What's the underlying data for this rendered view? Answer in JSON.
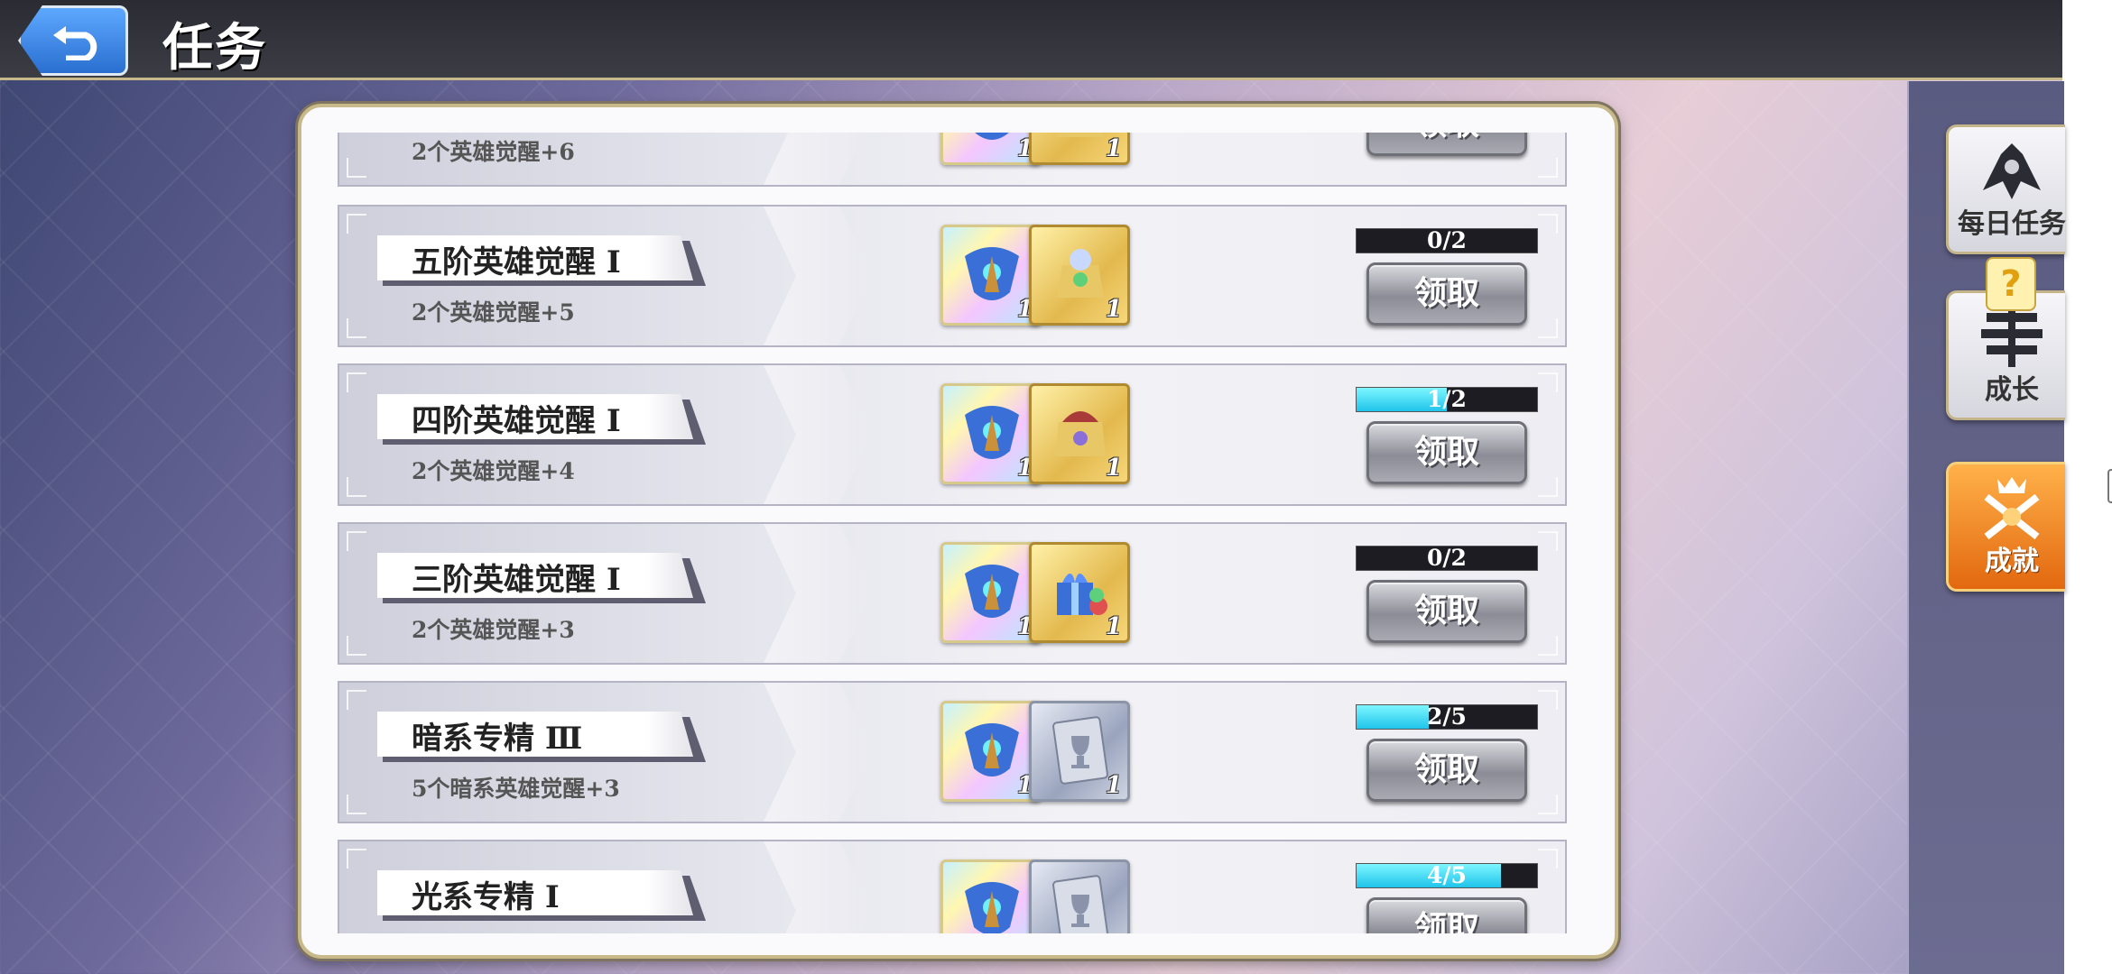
{
  "header": {
    "title": "任务"
  },
  "side_tabs": [
    {
      "label": "每日任务",
      "icon": "lion-crest-icon",
      "active": false
    },
    {
      "label": "成长",
      "icon": "tree-crest-icon",
      "active": false,
      "badge": "?"
    },
    {
      "label": "成就",
      "icon": "crossed-swords-crown-icon",
      "active": true
    }
  ],
  "claim_label": "领取",
  "tasks": [
    {
      "title": "",
      "desc": "2个英雄觉醒+6",
      "progress": null,
      "progress_text": "",
      "rewards": [
        {
          "kind": "rainbow",
          "icon": "wing-emblem-icon",
          "qty": "1"
        },
        {
          "kind": "gold",
          "icon": "treasure-pot-icon",
          "qty": "1"
        }
      ]
    },
    {
      "title": "五阶英雄觉醒 Ⅰ",
      "desc": "2个英雄觉醒+5",
      "progress": 0.0,
      "progress_text": "0/2",
      "rewards": [
        {
          "kind": "rainbow",
          "icon": "wing-emblem-icon",
          "qty": "1"
        },
        {
          "kind": "gold",
          "icon": "treasure-pot-icon",
          "qty": "1"
        }
      ]
    },
    {
      "title": "四阶英雄觉醒 Ⅰ",
      "desc": "2个英雄觉醒+4",
      "progress": 0.5,
      "progress_text": "1/2",
      "rewards": [
        {
          "kind": "rainbow",
          "icon": "wing-emblem-icon",
          "qty": "1"
        },
        {
          "kind": "gold",
          "icon": "treasure-pot-icon",
          "qty": "1"
        }
      ]
    },
    {
      "title": "三阶英雄觉醒 Ⅰ",
      "desc": "2个英雄觉醒+3",
      "progress": 0.0,
      "progress_text": "0/2",
      "rewards": [
        {
          "kind": "rainbow",
          "icon": "wing-emblem-icon",
          "qty": "1"
        },
        {
          "kind": "gold",
          "icon": "gift-box-icon",
          "qty": "1"
        }
      ]
    },
    {
      "title": "暗系专精 Ⅲ",
      "desc": "5个暗系英雄觉醒+3",
      "progress": 0.4,
      "progress_text": "2/5",
      "rewards": [
        {
          "kind": "rainbow",
          "icon": "wing-emblem-icon",
          "qty": "1"
        },
        {
          "kind": "silver",
          "icon": "trophy-card-icon",
          "qty": "1"
        }
      ]
    },
    {
      "title": "光系专精 Ⅰ",
      "desc": "",
      "progress": 0.8,
      "progress_text": "4/5",
      "rewards": [
        {
          "kind": "rainbow",
          "icon": "wing-emblem-icon",
          "qty": ""
        },
        {
          "kind": "silver",
          "icon": "trophy-card-icon",
          "qty": ""
        }
      ]
    }
  ],
  "colors": {
    "progress_fill": "#1fc4ea",
    "accent_gold": "#c8b98a",
    "active_tab": "#e2680e"
  }
}
